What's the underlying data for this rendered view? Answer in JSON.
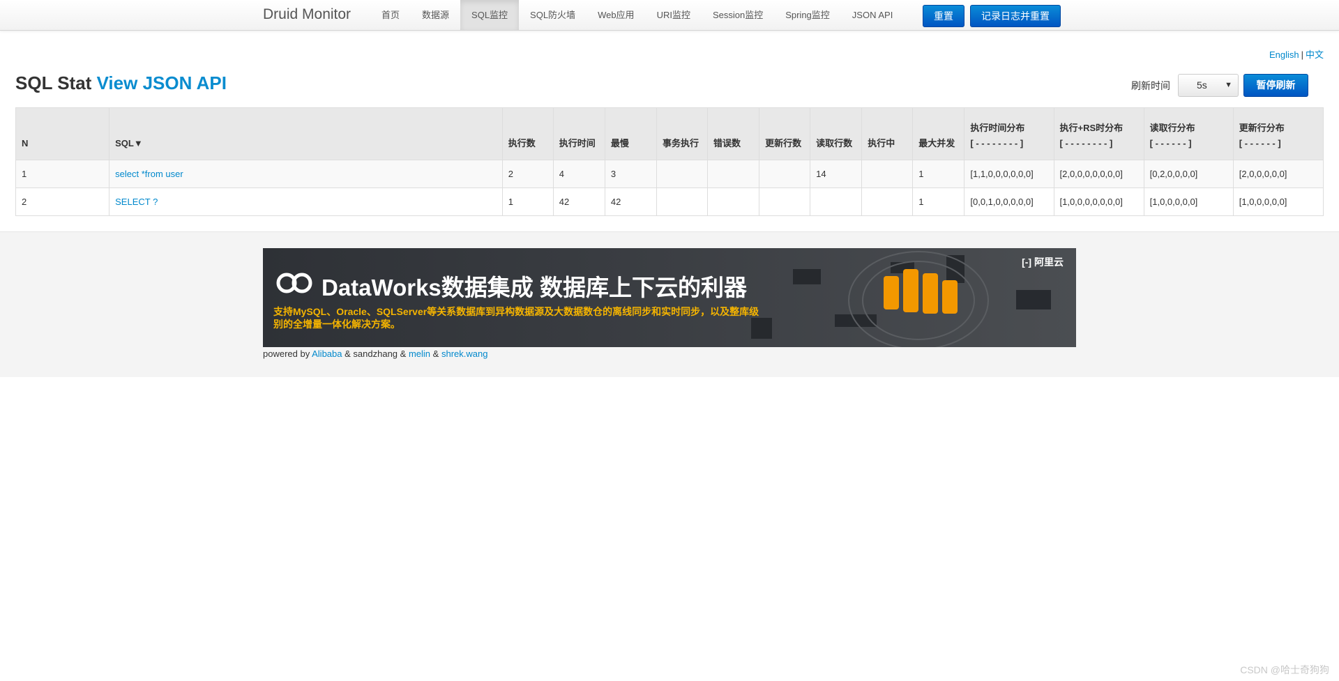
{
  "navbar": {
    "brand": "Druid Monitor",
    "items": [
      {
        "label": "首页"
      },
      {
        "label": "数据源"
      },
      {
        "label": "SQL监控",
        "active": true
      },
      {
        "label": "SQL防火墙"
      },
      {
        "label": "Web应用"
      },
      {
        "label": "URI监控"
      },
      {
        "label": "Session监控"
      },
      {
        "label": "Spring监控"
      },
      {
        "label": "JSON API"
      }
    ],
    "reset_label": "重置",
    "log_reset_label": "记录日志并重置"
  },
  "lang": {
    "english": "English",
    "separator": "|",
    "chinese": "中文"
  },
  "page": {
    "title_prefix": "SQL Stat",
    "title_link": "View JSON API"
  },
  "refresh": {
    "label": "刷新时间",
    "interval": "5s",
    "pause_label": "暂停刷新"
  },
  "table": {
    "headers": {
      "n": "N",
      "sql": "SQL▼",
      "exec_count": "执行数",
      "exec_time": "执行时间",
      "slowest": "最慢",
      "txn_exec": "事务执行",
      "errors": "错误数",
      "update_rows": "更新行数",
      "read_rows": "读取行数",
      "running": "执行中",
      "max_concurrency": "最大并发",
      "exec_time_dist": "执行时间分布",
      "exec_time_dist_sub": "[ - - - - - - - - ]",
      "exec_rs_dist": "执行+RS时分布",
      "exec_rs_dist_sub": "[ - - - - - - - - ]",
      "read_rows_dist": "读取行分布",
      "read_rows_dist_sub": "[ - - - - - - ]",
      "update_rows_dist": "更新行分布",
      "update_rows_dist_sub": "[ - - - - - - ]"
    },
    "rows": [
      {
        "n": "1",
        "sql": "select *from user",
        "exec_count": "2",
        "exec_time": "4",
        "slowest": "3",
        "txn_exec": "",
        "errors": "",
        "update_rows": "",
        "read_rows": "14",
        "running": "",
        "max_concurrency": "1",
        "exec_time_dist": "[1,1,0,0,0,0,0,0]",
        "exec_rs_dist": "[2,0,0,0,0,0,0,0]",
        "read_rows_dist": "[0,2,0,0,0,0]",
        "update_rows_dist": "[2,0,0,0,0,0]"
      },
      {
        "n": "2",
        "sql": "SELECT ?",
        "exec_count": "1",
        "exec_time": "42",
        "slowest": "42",
        "txn_exec": "",
        "errors": "",
        "update_rows": "",
        "read_rows": "",
        "running": "",
        "max_concurrency": "1",
        "exec_time_dist": "[0,0,1,0,0,0,0,0]",
        "exec_rs_dist": "[1,0,0,0,0,0,0,0]",
        "read_rows_dist": "[1,0,0,0,0,0]",
        "update_rows_dist": "[1,0,0,0,0,0]"
      }
    ]
  },
  "banner": {
    "headline": "DataWorks数据集成 数据库上下云的利器",
    "subtext": "支持MySQL、Oracle、SQLServer等关系数据库到异构数据源及大数据数仓的离线同步和实时同步，以及整库级别的全增量一体化解决方案。",
    "brand": "阿里云",
    "accent_color": "#f5b400"
  },
  "footer": {
    "powered_by": "powered by",
    "alibaba": "Alibaba",
    "amp1": "&",
    "sandzhang": "sandzhang",
    "amp2": "&",
    "melin": "melin",
    "amp3": "&",
    "shrek": "shrek.wang"
  },
  "watermark": "CSDN @哈士奇狗狗"
}
